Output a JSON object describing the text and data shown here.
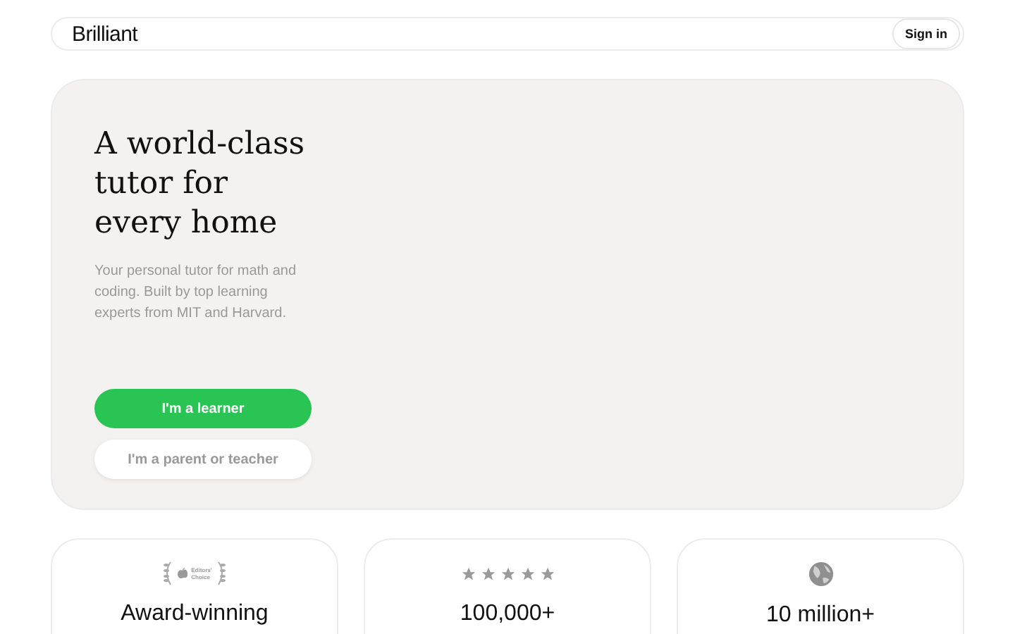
{
  "nav": {
    "logo": "Brilliant",
    "sign_in": "Sign in"
  },
  "hero": {
    "title": "A world-class tutor for every home",
    "subtitle": "Your personal tutor for math and coding. Built by top learning experts from MIT and Harvard.",
    "buttons": [
      {
        "label": "I'm a learner",
        "kind": "primary"
      },
      {
        "label": "I'm a parent or teacher",
        "kind": "secondary"
      }
    ]
  },
  "cards": [
    {
      "kind": "award",
      "badge_line_1": "Editors'",
      "badge_line_2": "Choice",
      "title": "Award-winning"
    },
    {
      "kind": "stars",
      "stars": 5,
      "title": "100,000+"
    },
    {
      "kind": "globe",
      "title": "10 million+"
    }
  ]
}
